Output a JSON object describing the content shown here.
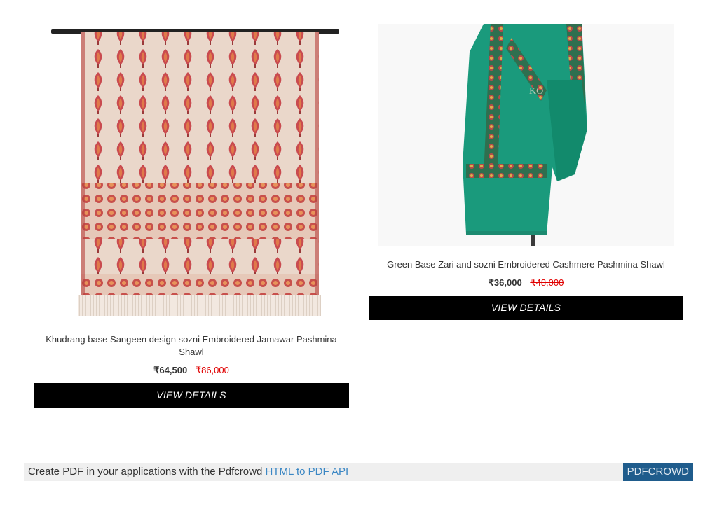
{
  "products": [
    {
      "title": "Khudrang base Sangeen design sozni Embroidered Jamawar Pashmina Shawl",
      "price": "₹64,500",
      "original_price": "₹86,000",
      "button_label": "VIEW DETAILS"
    },
    {
      "title": "Green Base Zari and sozni Embroidered Cashmere Pashmina Shawl",
      "price": "₹36,000",
      "original_price": "₹48,000",
      "button_label": "VIEW DETAILS",
      "image_watermark": "KO"
    }
  ],
  "footer": {
    "text": "Create PDF in your applications with the Pdfcrowd",
    "link_text": "HTML to PDF API",
    "brand_label": "PDFCROWD"
  }
}
